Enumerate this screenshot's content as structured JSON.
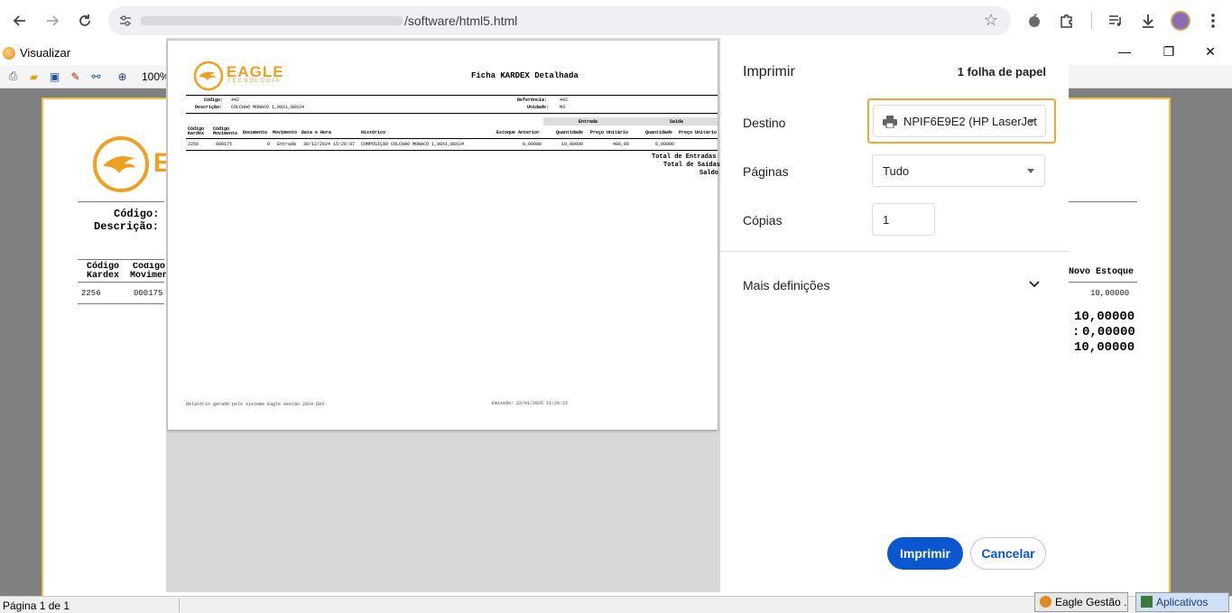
{
  "browser": {
    "url_suffix": "/software/html5.html"
  },
  "app": {
    "title": "Visualizar",
    "zoom": "100%",
    "status": "Página 1 de 1",
    "taskbar": [
      "Eagle Gestão ...",
      "Aplicativos"
    ],
    "background_report": {
      "codigo_label": "Código:",
      "descricao_label": "Descrição:",
      "col_codigo_kardex": "Código Kardex",
      "col_codigo_movimento": "Código Movimento",
      "col_novo_estoque": "Novo Estoque",
      "row_codigo_kardex": "2256",
      "row_codigo_movimento": "000175",
      "row_novo_estoque": "10,00000",
      "total_entradas": "10,00000",
      "total_saidas": "0,00000",
      "saldo": "10,00000"
    }
  },
  "preview": {
    "logo_name": "EAGLE",
    "logo_sub": "TECNOLOGIA",
    "title": "Ficha KARDEX Detalhada",
    "codigo_label": "Código:",
    "codigo_value": "442",
    "descricao_label": "Descrição:",
    "descricao_value": "COLCHAO MONACO 1,98X1,88X24",
    "referencia_label": "Referência:",
    "referencia_value": "442",
    "unidade_label": "Unidade:",
    "unidade_value": "M3",
    "group_entrada": "Entrada",
    "group_saida": "Saída",
    "columns": [
      "Código Kardex",
      "Código Movimento",
      "Documento",
      "Movimento",
      "Data e Hora",
      "Histórico",
      "Estoque Anterior",
      "Quantidade",
      "Preço Unitário",
      "Quantidade",
      "Preço Unitário"
    ],
    "row": {
      "codigo_kardex": "2256",
      "codigo_movimento": "000175",
      "documento": "0",
      "movimento": "Entrada",
      "data_hora": "30/12/2024 15:26:07",
      "historico": "COMPOSIÇÃO COLCHAO MONACO 1,98X1,88X24",
      "estoque_anterior": "0,00000",
      "entrada_quantidade": "10,00000",
      "entrada_preco": "480,00",
      "saida_quantidade": "0,00000"
    },
    "total_entradas_label": "Total de Entradas",
    "total_saidas_label": "Total de Saídas",
    "saldo_label": "Saldo",
    "footer_left": "Relatório gerado pelo sistema Eagle Gestão 2024.003",
    "footer_right": "Emissão: 22/01/2025  11:20:22"
  },
  "print_dialog": {
    "title": "Imprimir",
    "sheet_count": "1 folha de papel",
    "destination_label": "Destino",
    "destination_value": "NPIF6E9E2 (HP LaserJet",
    "pages_label": "Páginas",
    "pages_value": "Tudo",
    "copies_label": "Cópias",
    "copies_value": "1",
    "more_settings": "Mais definições",
    "print_button": "Imprimir",
    "cancel_button": "Cancelar",
    "accent_color": "#0b57d0",
    "highlight_color": "#f0a830"
  }
}
